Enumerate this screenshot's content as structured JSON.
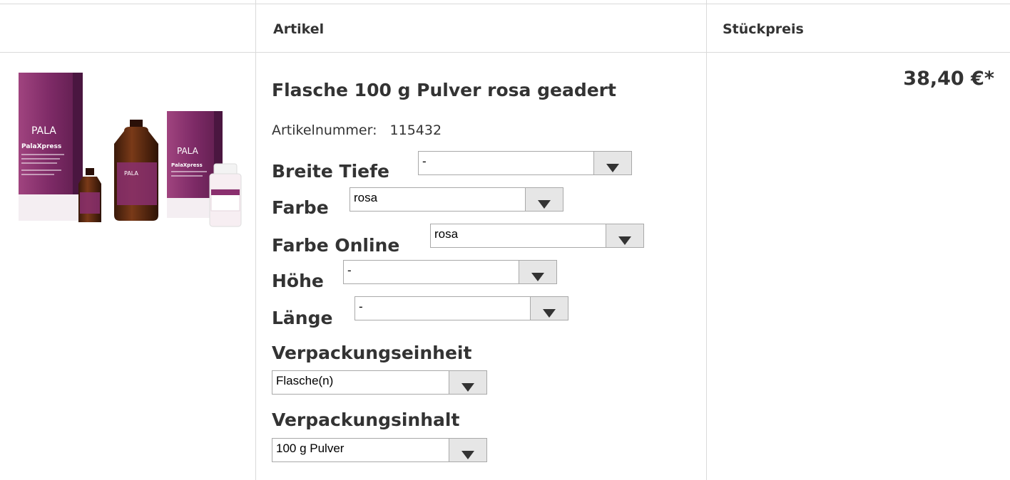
{
  "table": {
    "headers": {
      "artikel": "Artikel",
      "stueckpreis": "Stückpreis"
    }
  },
  "product": {
    "image_brand": "PALA",
    "image_product": "PalaXpress",
    "title": "Flasche 100 g Pulver rosa geadert",
    "artikelnummer_label": "Artikelnummer:",
    "artikelnummer": "115432",
    "price": "38,40 €*"
  },
  "options": {
    "breite_tiefe": {
      "label": "Breite Tiefe",
      "value": "-"
    },
    "farbe": {
      "label": "Farbe",
      "value": "rosa"
    },
    "farbe_online": {
      "label": "Farbe Online",
      "value": "rosa"
    },
    "hoehe": {
      "label": "Höhe",
      "value": "-"
    },
    "laenge": {
      "label": "Länge",
      "value": "-"
    },
    "verpackungseinheit": {
      "label": "Verpackungseinheit",
      "value": "Flasche(n)"
    },
    "verpackungsinhalt": {
      "label": "Verpackungsinhalt",
      "value": "100 g Pulver"
    }
  },
  "colors": {
    "border": "#dadada",
    "text": "#333333",
    "box_purple": "#8a2f6e",
    "bottle_brown": "#5a2a12"
  },
  "icons": {
    "dropdown": "triangle-down-icon"
  }
}
